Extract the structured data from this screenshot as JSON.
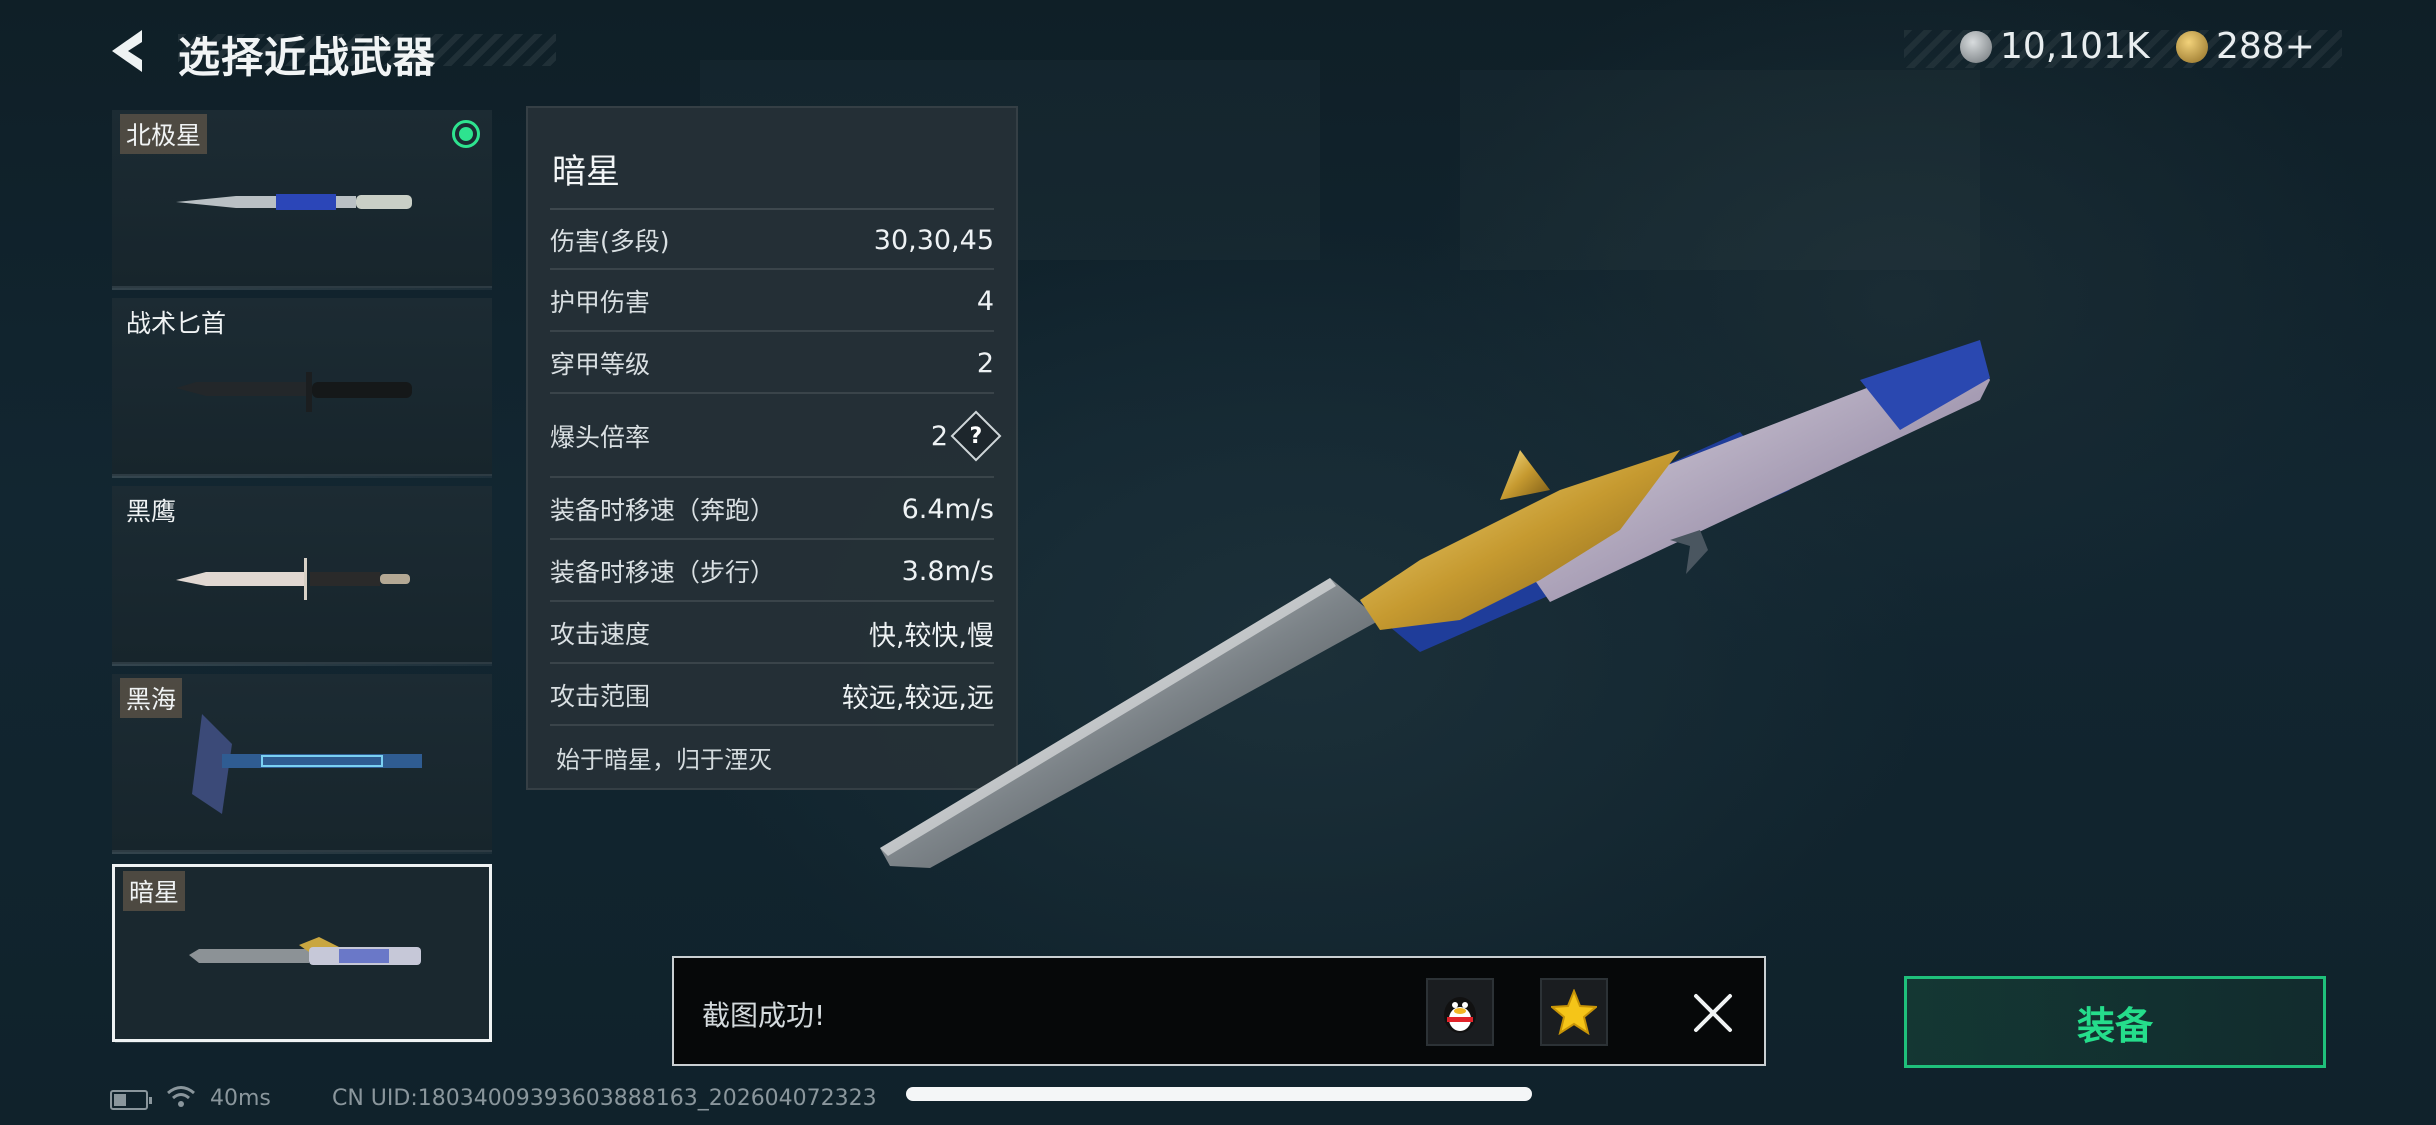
{
  "header": {
    "title": "选择近战武器"
  },
  "currency": [
    {
      "icon": "silver-coin-icon",
      "value": "10,101K"
    },
    {
      "icon": "gold-coin-icon",
      "value": "288+"
    }
  ],
  "weapons": [
    {
      "name": "北极星",
      "tagged": true,
      "equipped": true,
      "selected": false
    },
    {
      "name": "战术匕首",
      "tagged": false,
      "equipped": false,
      "selected": false
    },
    {
      "name": "黑鹰",
      "tagged": false,
      "equipped": false,
      "selected": false
    },
    {
      "name": "黑海",
      "tagged": true,
      "equipped": false,
      "selected": false
    },
    {
      "name": "暗星",
      "tagged": true,
      "equipped": false,
      "selected": true
    }
  ],
  "stats": {
    "name": "暗星",
    "rows": [
      {
        "label": "伤害(多段)",
        "value": "30,30,45"
      },
      {
        "label": "护甲伤害",
        "value": "4"
      },
      {
        "label": "穿甲等级",
        "value": "2"
      },
      {
        "label": "爆头倍率",
        "value": "2",
        "help": "?"
      },
      {
        "label": "装备时移速（奔跑）",
        "value": "6.4m/s"
      },
      {
        "label": "装备时移速（步行）",
        "value": "3.8m/s"
      },
      {
        "label": "攻击速度",
        "value": "快,较快,慢"
      },
      {
        "label": "攻击范围",
        "value": "较远,较远,远"
      }
    ],
    "description": "始于暗星，归于湮灭"
  },
  "toast": {
    "message": "截图成功!",
    "share_icons": [
      "qq-penguin-icon",
      "qzone-star-icon"
    ]
  },
  "equip_button": {
    "label": "装备"
  },
  "footer": {
    "ping": "40ms",
    "uid": "CN UID:18034009393603888163_202604072323"
  },
  "colors": {
    "accent": "#25dd8b",
    "equipped_indicator": "#2ee38f"
  }
}
